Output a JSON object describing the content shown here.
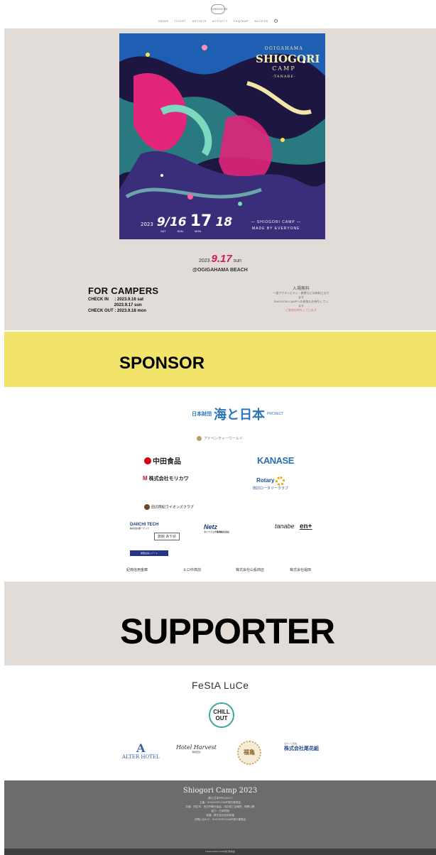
{
  "header": {
    "logo_text": "SHIOGORI",
    "nav": [
      "NEWS",
      "TICKET",
      "ARTISTS",
      "ACTIVITY",
      "FAQ/MAP",
      "ACCESS"
    ]
  },
  "poster": {
    "title_top": "OGIGAHAMA",
    "title_main": "SHIOGORI",
    "title_camp": "CAMP",
    "title_sub": "-TANABE-",
    "year": "2023",
    "date1": "9/16",
    "date2": "17",
    "date3": "18",
    "days": [
      "SAT",
      "SUN",
      "MON"
    ],
    "tag1": "— SHIOGORI CAMP —",
    "tag2": "MADE BY EVERYONE",
    "colors": {
      "deep": "#1c1640",
      "magenta": "#e0257a",
      "mint": "#7dd8c0",
      "blue": "#1f5fb3",
      "cream": "#f3edb0"
    }
  },
  "event": {
    "date_prefix": "2023.",
    "date_em": "9.17",
    "date_suffix": "sun",
    "place": "@OGIGAHAMA BEACH"
  },
  "campers": {
    "title": "FOR CAMPERS",
    "check_in_1": "CHECK IN     : 2023.9.16 sat",
    "check_in_2": "                      2023.9.17 sun",
    "check_out": "CHECK OUT : 2023.9.18 mon"
  },
  "admission": {
    "title": "入場無料",
    "line1": "一部アクティビティ・飲食などは有料となります",
    "line2": "SHIOGORI CAMPへの参加もお待ちしています",
    "red": "ご参加お待ちしています"
  },
  "sponsor": {
    "heading": "SPONSOR",
    "umi_small": "日本財団",
    "umi_main": "海と日本",
    "umi_project": "PROJECT",
    "adventure": "アドベンチャーワールド",
    "nakata": "中田食品",
    "kanase": "KANASE",
    "morikawa": "株式会社モリカワ",
    "rotary": "Rotary",
    "rotary_sub": "田辺ロータリークラブ",
    "lions": "田辺南紀ライオンズクラブ",
    "daiichi": "DAIICHI TECH",
    "daiichi_sub": "株式会社第一テック",
    "ayame": "旅館 あやめ",
    "netz": "Netz",
    "netz_sub": "ネッツトヨタ南海株式会社",
    "tanabe": "tanabe",
    "ent": "en+",
    "navy": "熊野白浜リゾート",
    "small1": "紀南信用金庫",
    "small2": "ヒロ中高前",
    "small3": "株式会社山長商店",
    "small4": "株式会社堀田"
  },
  "supporter": {
    "heading": "SUPPORTER",
    "festa": "FeStA LuCe",
    "chill1": "CHILL",
    "chill2": "OUT",
    "alter": "ALTER HOTEL",
    "harvest": "Hotel Harvest",
    "harvest_sub": "南紀田辺",
    "seal": "福亀",
    "ushu": "株式会社尾花組",
    "ushu_sub": "きのくに建設"
  },
  "footer": {
    "title": "Shiogori Camp 2023",
    "sub": "-海と日本PROJECT-",
    "lines": [
      "主催：SHIOGORI CAMP実行委員会",
      "共催：田辺市、田辺市観光協会、田辺商工会議所、和歌山県",
      "協力：日本財団",
      "後援：株式会社紀伊民報",
      "お問い合わせ：SHIOGORI CAMP実行委員会"
    ],
    "copyright": "©SHIOGORI CAMP実行委員会"
  }
}
